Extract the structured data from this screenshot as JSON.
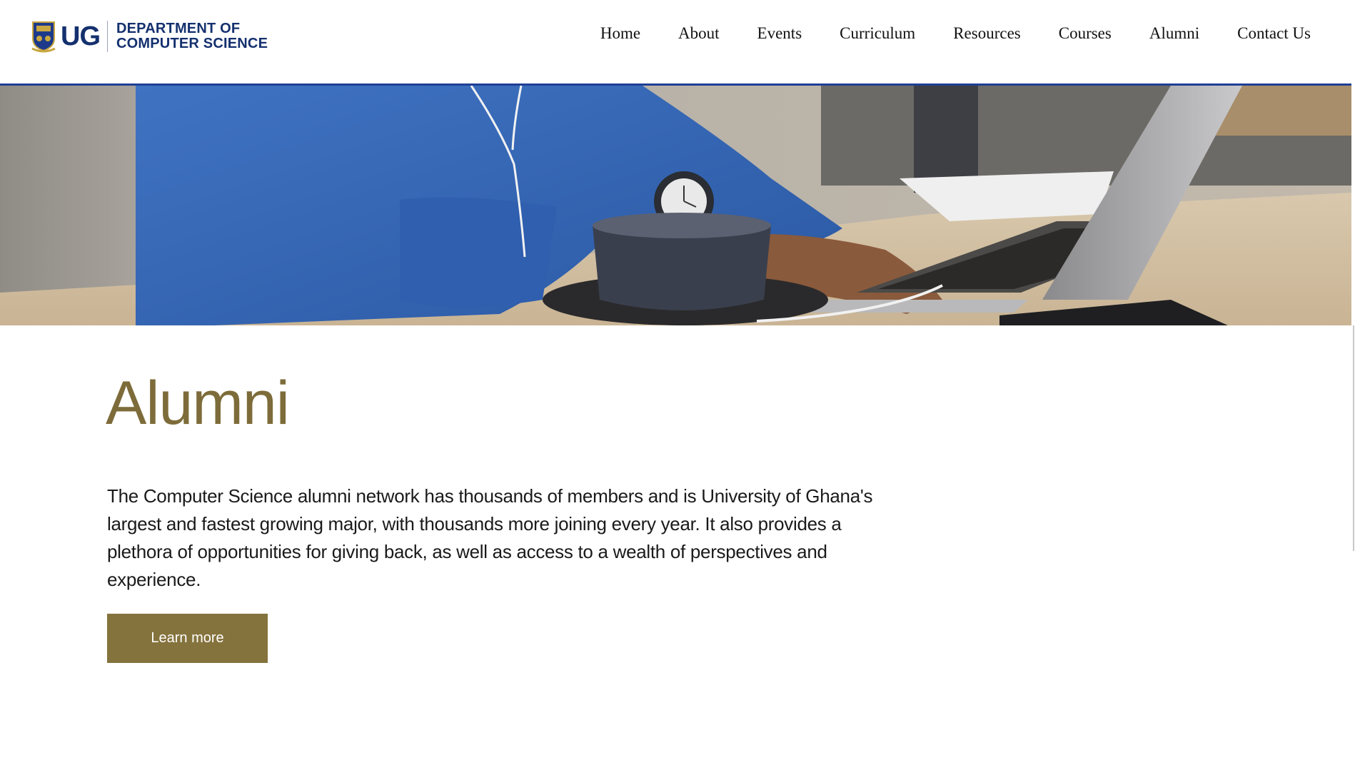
{
  "brand": {
    "logo_mark": "UG",
    "line1": "DEPARTMENT OF",
    "line2": "COMPUTER SCIENCE",
    "color": "#14306e"
  },
  "nav": {
    "items": [
      {
        "label": "Home"
      },
      {
        "label": "About"
      },
      {
        "label": "Events"
      },
      {
        "label": "Curriculum"
      },
      {
        "label": "Resources"
      },
      {
        "label": "Courses"
      },
      {
        "label": "Alumni"
      },
      {
        "label": "Contact Us"
      }
    ]
  },
  "hero": {
    "image": "person-typing-on-laptop-with-coffee-photo"
  },
  "main": {
    "title": "Alumni",
    "description": "The Computer Science alumni network has thousands of members and is University of Ghana's largest and fastest growing major, with thousands more joining every year. It also provides a plethora of opportunities for giving back, as well as access to a wealth of perspectives and experience.",
    "button_label": "Learn more"
  },
  "colors": {
    "accent_gold": "#85733d",
    "title_gold": "#7d6c3a",
    "header_border": "#1f3f95"
  }
}
